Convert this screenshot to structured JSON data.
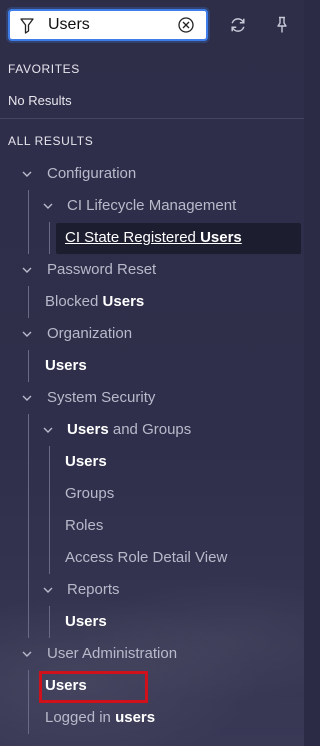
{
  "search": {
    "value": "Users"
  },
  "favorites": {
    "header": "FAVORITES",
    "empty_text": "No Results"
  },
  "all_results": {
    "header": "ALL RESULTS",
    "items": [
      {
        "prefix": "",
        "match": "",
        "suffix": "Configuration"
      },
      {
        "prefix": "",
        "match": "",
        "suffix": "CI Lifecycle Management"
      },
      {
        "prefix": "CI State Registered ",
        "match": "Users",
        "suffix": ""
      },
      {
        "prefix": "",
        "match": "",
        "suffix": "Password Reset"
      },
      {
        "prefix": "Blocked ",
        "match": "Users",
        "suffix": ""
      },
      {
        "prefix": "",
        "match": "",
        "suffix": "Organization"
      },
      {
        "prefix": "",
        "match": "Users",
        "suffix": ""
      },
      {
        "prefix": "",
        "match": "",
        "suffix": "System Security"
      },
      {
        "prefix": "",
        "match": "Users",
        "suffix": " and Groups"
      },
      {
        "prefix": "",
        "match": "Users",
        "suffix": ""
      },
      {
        "prefix": "",
        "match": "",
        "suffix": "Groups"
      },
      {
        "prefix": "",
        "match": "",
        "suffix": "Roles"
      },
      {
        "prefix": "",
        "match": "",
        "suffix": "Access Role Detail View"
      },
      {
        "prefix": "",
        "match": "",
        "suffix": "Reports"
      },
      {
        "prefix": "",
        "match": "Users",
        "suffix": ""
      },
      {
        "prefix": "",
        "match": "",
        "suffix": "User Administration"
      },
      {
        "prefix": "",
        "match": "Users",
        "suffix": ""
      },
      {
        "prefix": "Logged in ",
        "match": "users",
        "suffix": ""
      }
    ]
  },
  "colors": {
    "background": "#2e2e49",
    "search_border": "#3f7ee8",
    "highlight_box": "#d0111b",
    "selected_row": "#1d1d30"
  }
}
